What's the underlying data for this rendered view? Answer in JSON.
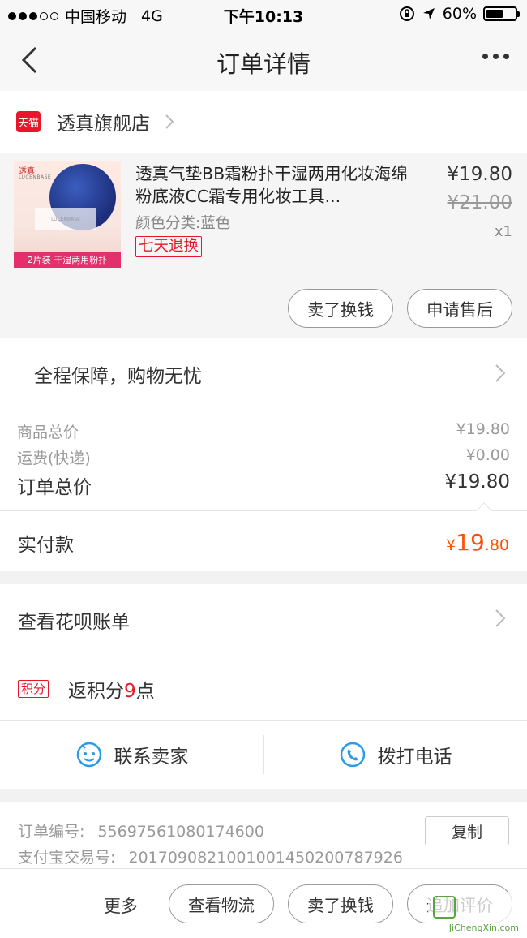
{
  "status_bar": {
    "carrier": "中国移动",
    "network": "4G",
    "time": "下午10:13",
    "battery": "60%"
  },
  "nav": {
    "title": "订单详情"
  },
  "store": {
    "badge": "天猫",
    "name": "透真旗舰店"
  },
  "product": {
    "thumb_brand": "透真",
    "thumb_brand_sub": "LUCENBASE",
    "thumb_box_text": "LUCENBASE",
    "thumb_banner": "2片装 干湿两用粉扑",
    "title": "透真气垫BB霜粉扑干湿两用化妆海绵粉底液CC霜专用化妆工具...",
    "spec": "颜色分类:蓝色",
    "tag": "七天退换",
    "price": "¥19.80",
    "original_price": "¥21.00",
    "quantity": "x1",
    "sell_button": "卖了换钱",
    "aftersale_button": "申请售后"
  },
  "guarantee": {
    "label": "全程保障，购物无忧"
  },
  "summary": {
    "goods_label": "商品总价",
    "goods_value": "¥19.80",
    "shipping_label": "运费(快递)",
    "shipping_value": "¥0.00",
    "total_label": "订单总价",
    "total_value": "¥19.80",
    "paid_label": "实付款",
    "paid_symbol": "¥",
    "paid_int": "19",
    "paid_dec": ".80"
  },
  "huabei": {
    "label": "查看花呗账单"
  },
  "points": {
    "badge": "积分",
    "prefix": "返积分",
    "value": "9",
    "suffix": "点"
  },
  "contact": {
    "seller": "联系卖家",
    "phone": "拨打电话"
  },
  "order_info": {
    "order_no_label": "订单编号:",
    "order_no": "55697561080174600",
    "alipay_label": "支付宝交易号:",
    "alipay_no": "2017090821001001450200787926",
    "copy_button": "复制"
  },
  "bottom_bar": {
    "more": "更多",
    "logistics_button": "查看物流",
    "sell_button": "卖了换钱",
    "review_button": "追加评价"
  },
  "watermark": {
    "text": "JiChengXin.com"
  },
  "colors": {
    "accent": "#ff5000",
    "tmall_red": "#e8162a"
  }
}
